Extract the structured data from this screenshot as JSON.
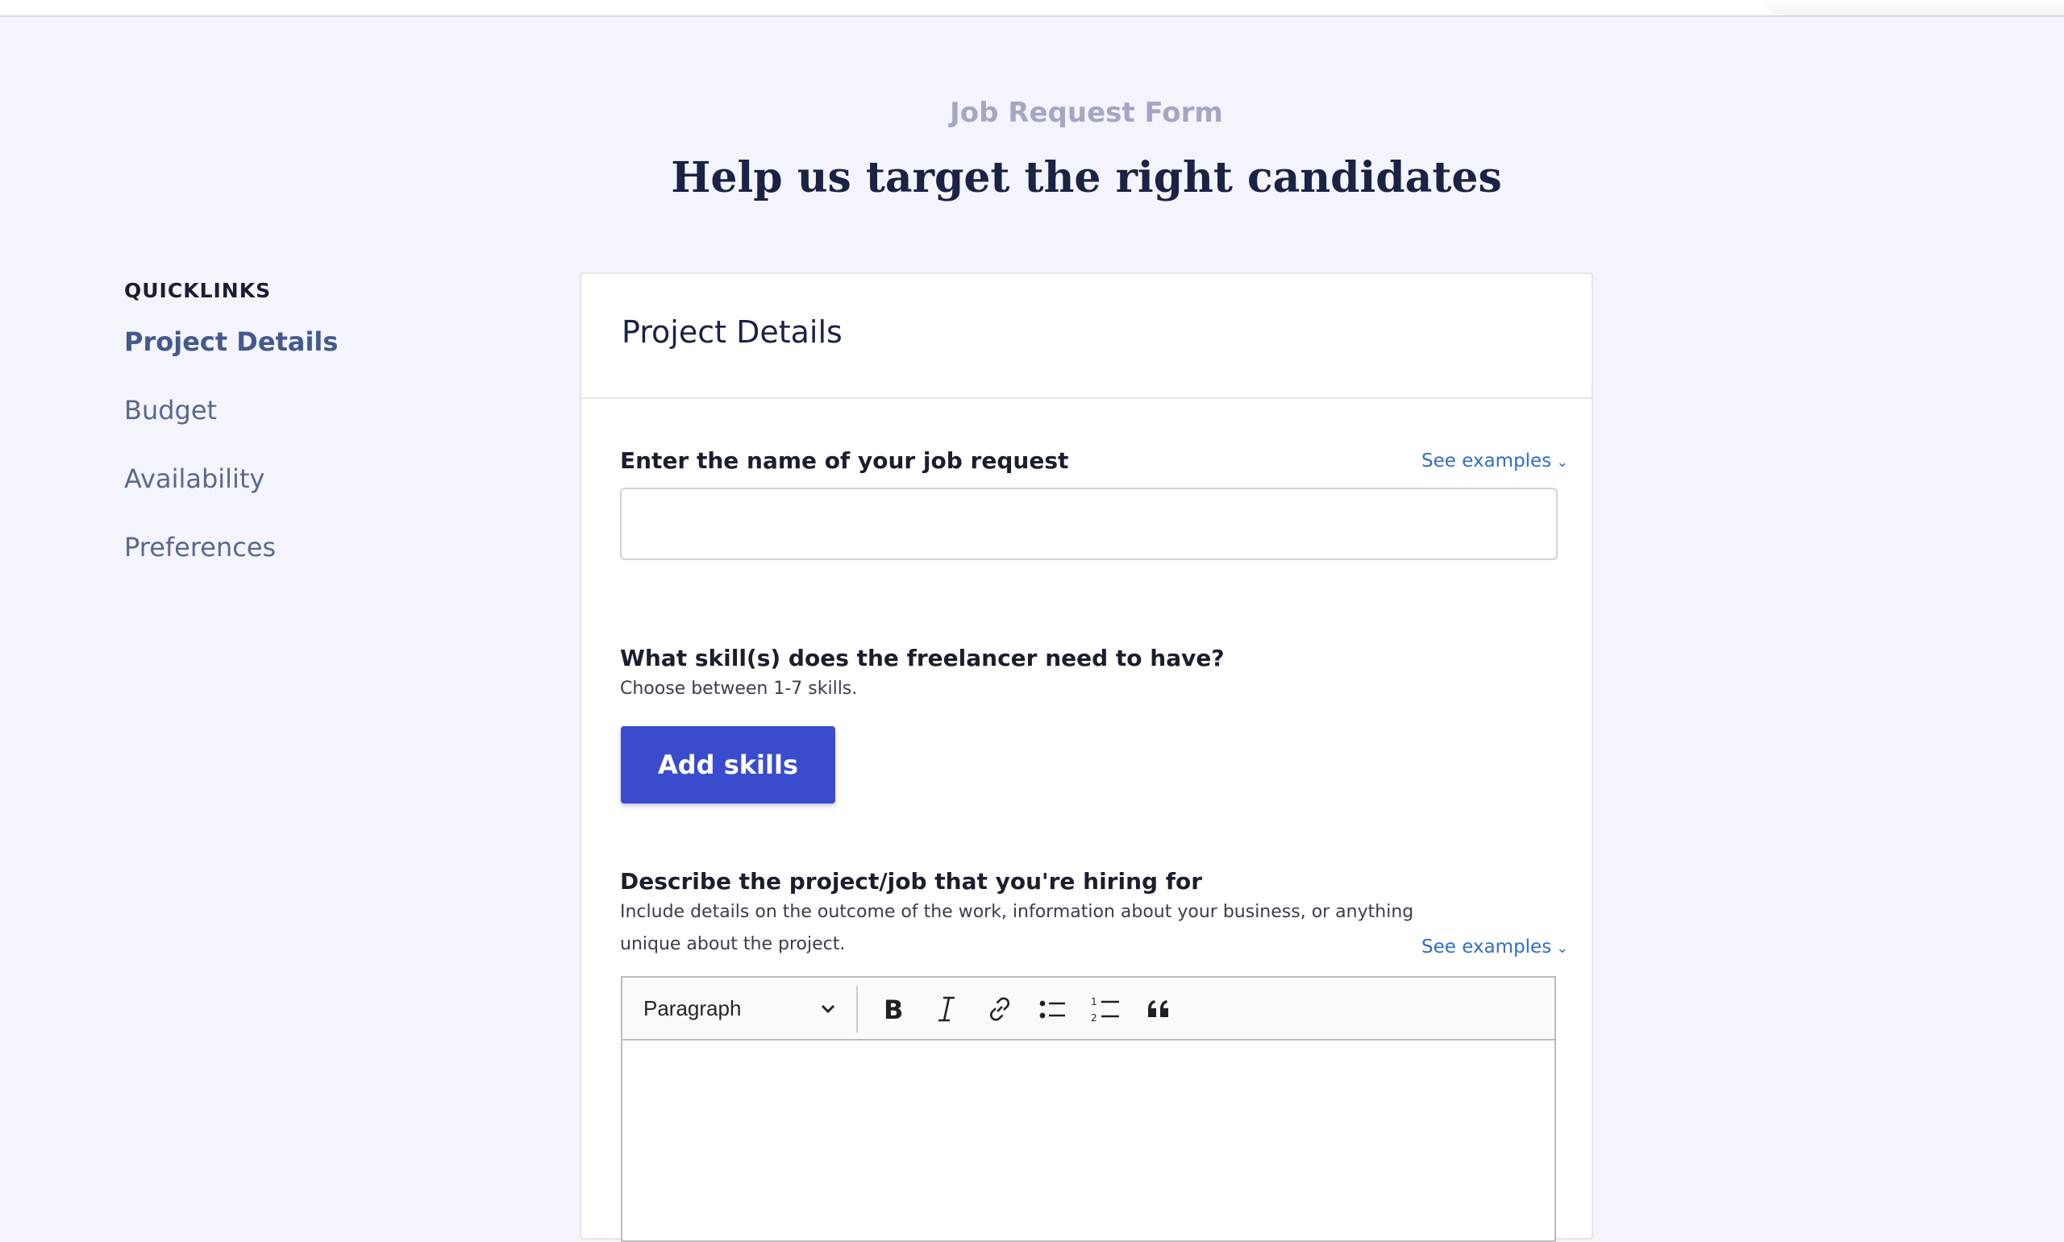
{
  "page": {
    "eyebrow": "Job Request Form",
    "headline": "Help us target the right candidates"
  },
  "quicklinks": {
    "title": "QUICKLINKS",
    "items": [
      {
        "label": "Project Details",
        "active": true
      },
      {
        "label": "Budget",
        "active": false
      },
      {
        "label": "Availability",
        "active": false
      },
      {
        "label": "Preferences",
        "active": false
      }
    ]
  },
  "card": {
    "title": "Project Details",
    "job_name": {
      "label": "Enter the name of your job request",
      "see_examples": "See examples",
      "value": "",
      "placeholder": ""
    },
    "skills": {
      "label": "What skill(s) does the freelancer need to have?",
      "help": "Choose between 1-7 skills.",
      "button": "Add skills"
    },
    "description": {
      "label": "Describe the project/job that you're hiring for",
      "help_line1": "Include details on the outcome of the work, information about your business, or anything",
      "help_line2": "unique about the project.",
      "see_examples": "See examples",
      "format_select": "Paragraph",
      "toolbar_icons": [
        "bold-icon",
        "italic-icon",
        "link-icon",
        "bulleted-list-icon",
        "numbered-list-icon",
        "blockquote-icon"
      ]
    }
  },
  "colors": {
    "background": "#f3f4fc",
    "accent_button": "#3a4bcd",
    "link": "#2f6dc9",
    "heading": "#1a2343"
  }
}
